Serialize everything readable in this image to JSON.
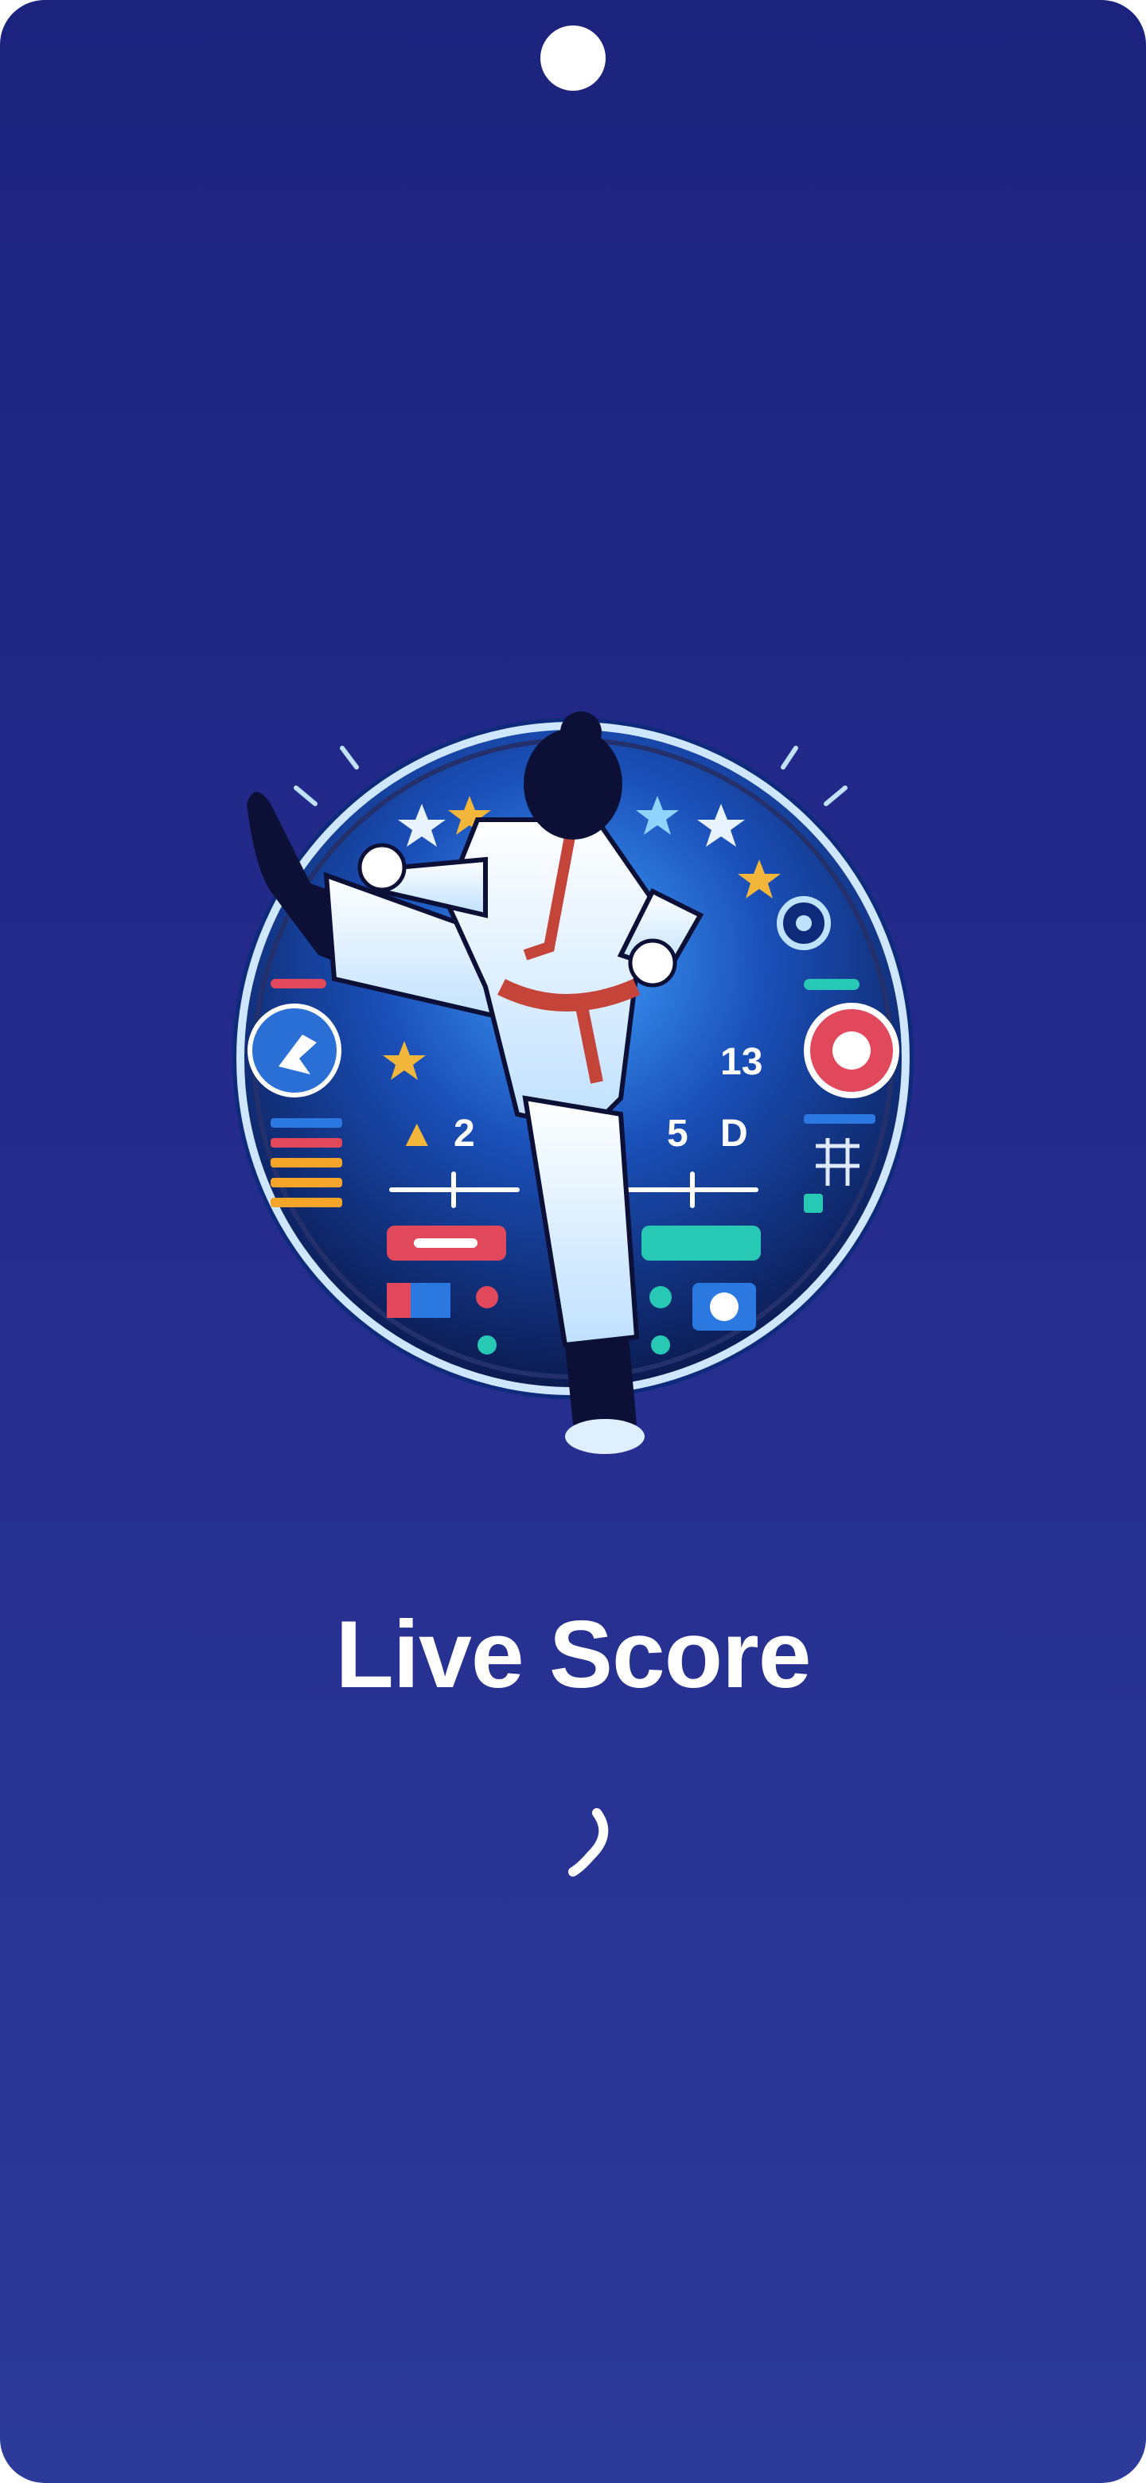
{
  "splash": {
    "title": "Live Score",
    "logo_icon": "karate-fighter-scoreboard-logo",
    "loading_icon": "loading-spinner-icon"
  },
  "colors": {
    "background_top": "#1c237d",
    "background_bottom": "#2c3a99",
    "title_text": "#ffffff"
  }
}
